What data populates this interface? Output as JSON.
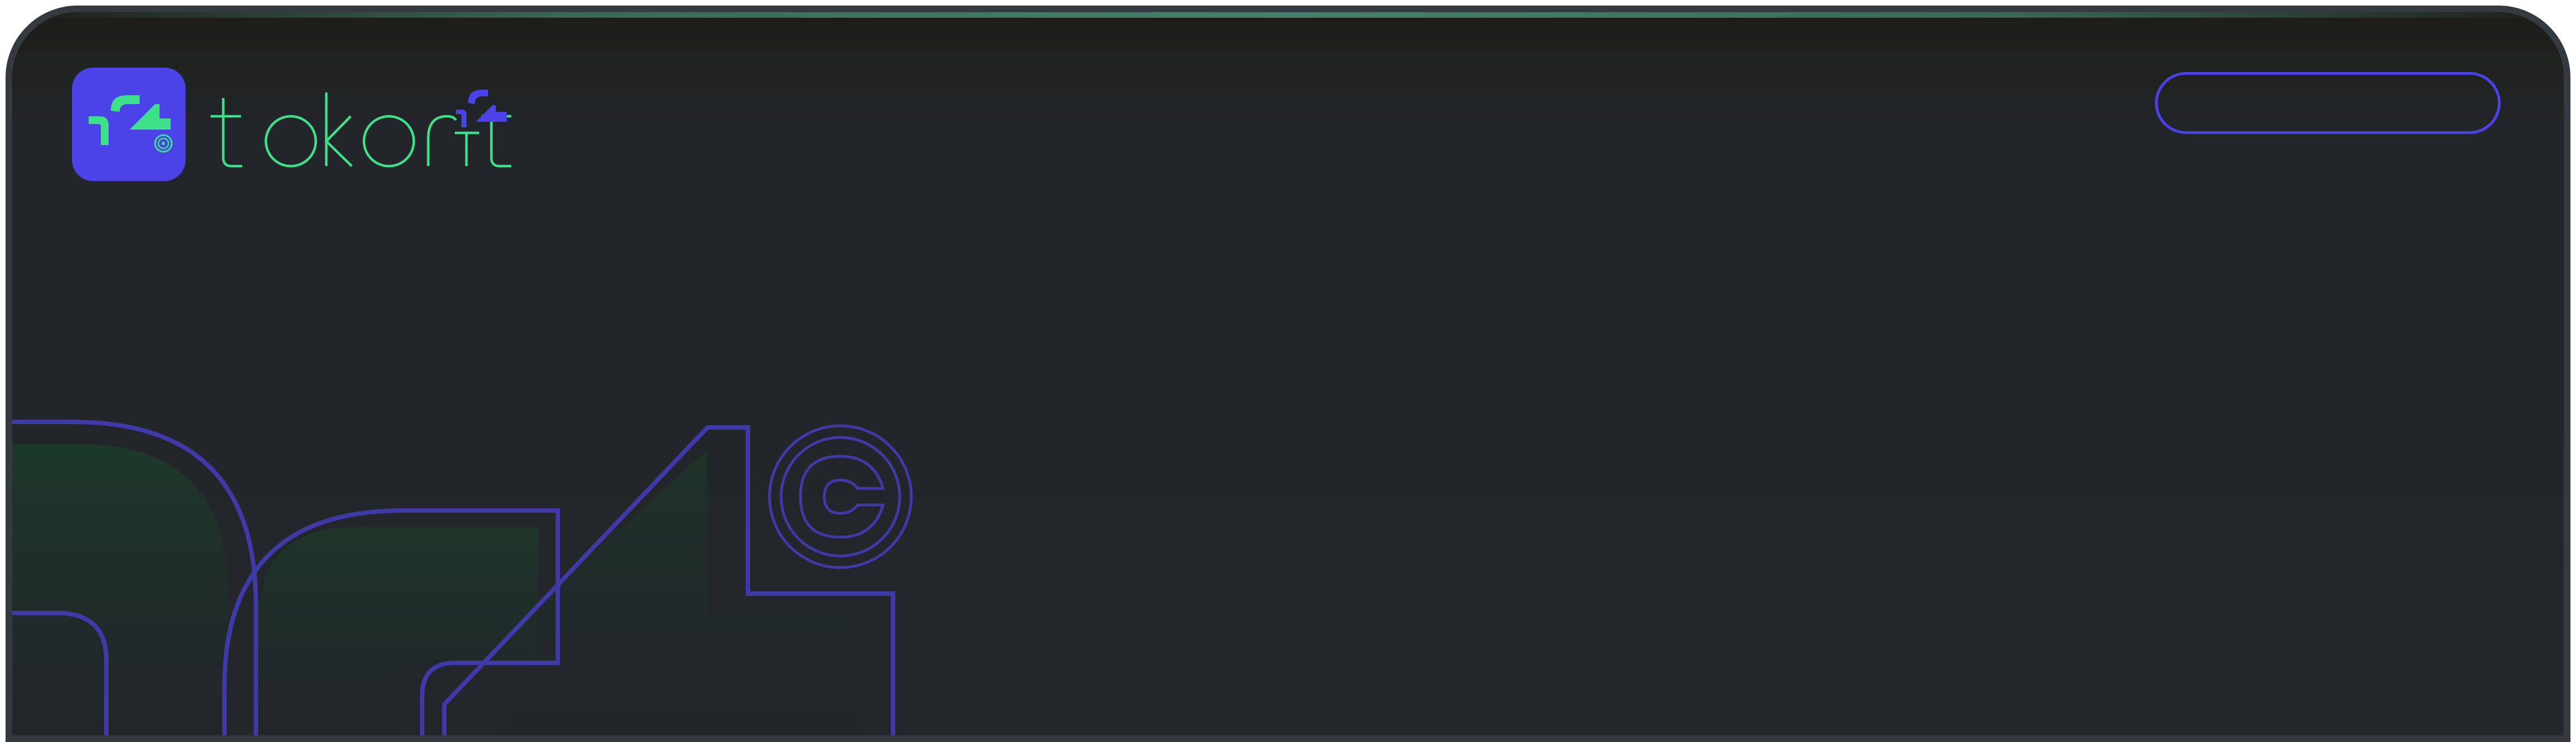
{
  "brand": {
    "name": "tokonft",
    "icon": "tokonft-logo-icon",
    "primary_color": "#4b42e8",
    "accent_color": "#3ee08a"
  },
  "header": {
    "cta_label": ""
  },
  "theme": {
    "background": "#23262b",
    "frame": "#353a40",
    "hero_outline": "#3f3aa8"
  }
}
